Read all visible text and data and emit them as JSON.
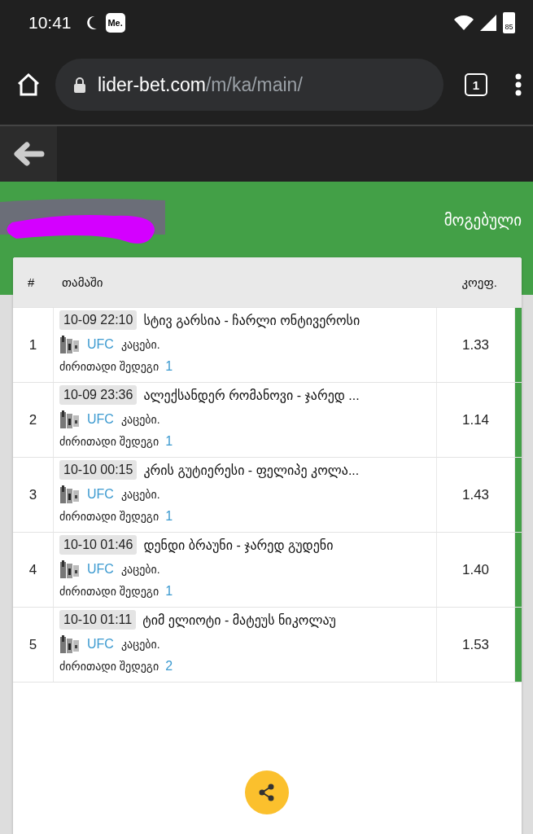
{
  "status_bar": {
    "time": "10:41",
    "app_badge": "Me.",
    "battery": "85"
  },
  "browser": {
    "url_host": "lider-bet.com",
    "url_path": "/m/ka/main/",
    "tab_count": "1"
  },
  "header": {
    "status": "მოგებული"
  },
  "table": {
    "columns": [
      "#",
      "თამაში",
      "კოეფ."
    ],
    "rows": [
      {
        "index": "1",
        "time": "10-09 22:10",
        "title": "სტივ გარსია - ჩარლი ონტივეროსი",
        "league": "UFC",
        "category": "კაცები.",
        "market": "ძირითადი შედეგი",
        "pick": "1",
        "odds": "1.33",
        "won": true
      },
      {
        "index": "2",
        "time": "10-09 23:36",
        "title": "ალექსანდერ რომანოვი - ჯარედ ...",
        "league": "UFC",
        "category": "კაცები.",
        "market": "ძირითადი შედეგი",
        "pick": "1",
        "odds": "1.14",
        "won": true
      },
      {
        "index": "3",
        "time": "10-10 00:15",
        "title": "კრის გუტიერესი - ფელიპე კოლა...",
        "league": "UFC",
        "category": "კაცები.",
        "market": "ძირითადი შედეგი",
        "pick": "1",
        "odds": "1.43",
        "won": true
      },
      {
        "index": "4",
        "time": "10-10 01:46",
        "title": "დენდი ბრაუნი - ჯარედ გუდენი",
        "league": "UFC",
        "category": "კაცები.",
        "market": "ძირითადი შედეგი",
        "pick": "1",
        "odds": "1.40",
        "won": true
      },
      {
        "index": "5",
        "time": "10-10 01:11",
        "title": "ტიმ ელიოტი - მატეუს ნიკოლაუ",
        "league": "UFC",
        "category": "კაცები.",
        "market": "ძირითადი შედეგი",
        "pick": "2",
        "odds": "1.53",
        "won": true
      }
    ]
  }
}
